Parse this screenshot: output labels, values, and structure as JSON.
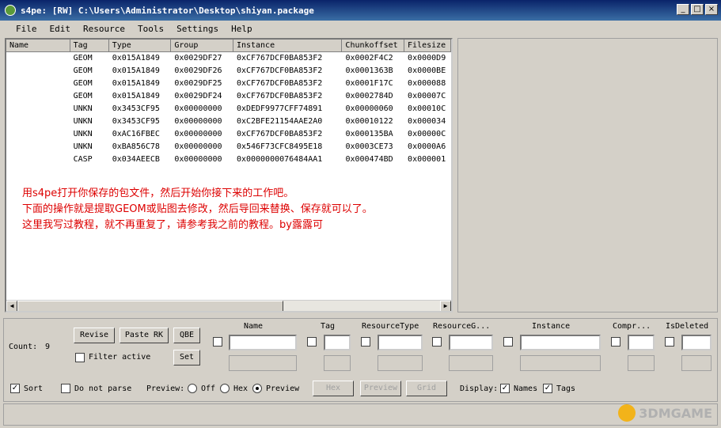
{
  "window": {
    "title": "s4pe: [RW] C:\\Users\\Administrator\\Desktop\\shiyan.package"
  },
  "menu": [
    "File",
    "Edit",
    "Resource",
    "Tools",
    "Settings",
    "Help"
  ],
  "grid": {
    "columns": [
      "Name",
      "Tag",
      "Type",
      "Group",
      "Instance",
      "Chunkoffset",
      "Filesize"
    ],
    "rows": [
      [
        "",
        "GEOM",
        "0x015A1849",
        "0x0029DF27",
        "0xCF767DCF0BA853F2",
        "0x0002F4C2",
        "0x0000D9"
      ],
      [
        "",
        "GEOM",
        "0x015A1849",
        "0x0029DF26",
        "0xCF767DCF0BA853F2",
        "0x0001363B",
        "0x0000BE"
      ],
      [
        "",
        "GEOM",
        "0x015A1849",
        "0x0029DF25",
        "0xCF767DCF0BA853F2",
        "0x0001F17C",
        "0x000088"
      ],
      [
        "",
        "GEOM",
        "0x015A1849",
        "0x0029DF24",
        "0xCF767DCF0BA853F2",
        "0x0002784D",
        "0x00007C"
      ],
      [
        "",
        "UNKN",
        "0x3453CF95",
        "0x00000000",
        "0xDEDF9977CFF74891",
        "0x00000060",
        "0x00010C"
      ],
      [
        "",
        "UNKN",
        "0x3453CF95",
        "0x00000000",
        "0xC2BFE21154AAE2A0",
        "0x00010122",
        "0x000034"
      ],
      [
        "",
        "UNKN",
        "0xAC16FBEC",
        "0x00000000",
        "0xCF767DCF0BA853F2",
        "0x000135BA",
        "0x00000C"
      ],
      [
        "",
        "UNKN",
        "0xBA856C78",
        "0x00000000",
        "0x546F73CFC8495E18",
        "0x0003CE73",
        "0x0000A6"
      ],
      [
        "",
        "CASP",
        "0x034AEECB",
        "0x00000000",
        "0x0000000076484AA1",
        "0x000474BD",
        "0x000001"
      ]
    ]
  },
  "note": [
    "用s4pe打开你保存的包文件，然后开始你接下来的工作吧。",
    "下面的操作就是提取GEOM或贴图去修改，然后导回来替换、保存就可以了。",
    "这里我写过教程，就不再重复了，请参考我之前的教程。by露露可"
  ],
  "bottom": {
    "count_label": "Count:",
    "count_value": "9",
    "revise": "Revise",
    "paste_rk": "Paste RK",
    "qbe": "QBE",
    "set": "Set",
    "filter_active": "Filter active",
    "filter_columns": [
      "Name",
      "Tag",
      "ResourceType",
      "ResourceG...",
      "Instance",
      "Compr...",
      "IsDeleted"
    ],
    "sort": "Sort",
    "do_not_parse": "Do not parse",
    "preview_label": "Preview:",
    "preview_off": "Off",
    "preview_hex": "Hex",
    "preview_preview": "Preview",
    "hex_btn": "Hex",
    "preview_btn": "Preview",
    "grid_btn": "Grid",
    "display_label": "Display:",
    "names": "Names",
    "tags": "Tags",
    "check_mark": "✓"
  },
  "watermark": "3DMGAME"
}
